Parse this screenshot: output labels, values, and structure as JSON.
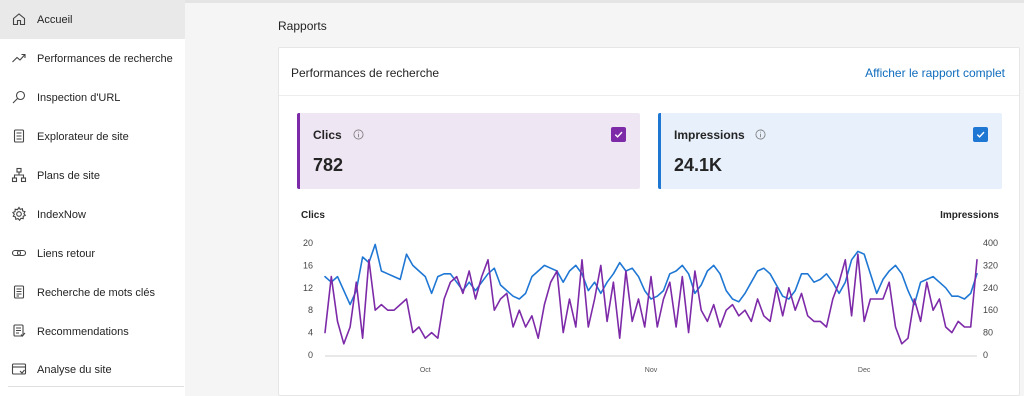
{
  "sidebar": {
    "items": [
      {
        "label": "Accueil",
        "icon": "home-icon",
        "active": true
      },
      {
        "label": "Performances de recherche",
        "icon": "trend-up-icon"
      },
      {
        "label": "Inspection d'URL",
        "icon": "search-icon"
      },
      {
        "label": "Explorateur de site",
        "icon": "document-icon"
      },
      {
        "label": "Plans de site",
        "icon": "sitemap-icon"
      },
      {
        "label": "IndexNow",
        "icon": "gear-icon"
      },
      {
        "label": "Liens retour",
        "icon": "link-icon"
      },
      {
        "label": "Recherche de mots clés",
        "icon": "document-list-icon"
      },
      {
        "label": "Recommendations",
        "icon": "recommendation-icon"
      },
      {
        "label": "Analyse du site",
        "icon": "window-icon"
      }
    ]
  },
  "main": {
    "section_title": "Rapports",
    "card": {
      "title": "Performances de recherche",
      "link_label": "Afficher le rapport complet",
      "metrics": {
        "clics": {
          "label": "Clics",
          "value": "782",
          "checked": true,
          "color": "#7d2aa8"
        },
        "impressions": {
          "label": "Impressions",
          "value": "24.1K",
          "checked": true,
          "color": "#1f77d4"
        }
      }
    }
  },
  "chart_data": {
    "type": "line",
    "left_axis_label": "Clics",
    "right_axis_label": "Impressions",
    "y_left_ticks": [
      "20",
      "16",
      "12",
      "8",
      "4",
      "0"
    ],
    "y_right_ticks": [
      "400",
      "320",
      "240",
      "160",
      "80",
      "0"
    ],
    "ylim_left": [
      0,
      20
    ],
    "ylim_right": [
      0,
      400
    ],
    "x_tick_labels": [
      "Oct",
      "Nov",
      "Dec"
    ],
    "x_tick_index": [
      16,
      52,
      86
    ],
    "grid": false,
    "series": [
      {
        "name": "Clics",
        "axis": "left",
        "color": "#7d2aa8",
        "values": [
          4,
          14,
          6,
          2,
          5,
          13,
          3,
          17,
          8,
          9,
          8,
          8,
          9,
          10,
          4,
          5,
          3,
          4,
          3,
          10,
          13,
          14,
          11,
          15,
          10,
          14,
          17,
          8,
          10,
          11,
          5,
          8,
          5,
          7,
          3,
          9,
          13,
          15,
          4,
          10,
          5,
          17,
          5,
          10,
          16,
          6,
          13,
          3,
          15,
          6,
          10,
          5,
          14,
          5,
          10,
          13,
          5,
          14,
          4,
          15,
          8,
          6,
          9,
          5,
          8,
          9,
          7,
          8,
          6,
          10,
          7,
          6,
          12,
          7,
          12,
          8,
          11,
          7,
          6,
          6,
          5,
          10,
          13,
          17,
          7,
          18,
          6,
          10,
          10,
          10,
          13,
          5,
          2,
          3,
          10,
          6,
          13,
          8,
          10,
          5,
          4,
          6,
          5,
          5,
          17
        ]
      },
      {
        "name": "Impressions",
        "axis": "right",
        "color": "#1f77d4",
        "values": [
          280,
          260,
          280,
          230,
          180,
          230,
          350,
          330,
          395,
          300,
          290,
          280,
          270,
          360,
          320,
          300,
          280,
          220,
          280,
          290,
          290,
          260,
          230,
          260,
          230,
          260,
          290,
          310,
          250,
          230,
          210,
          200,
          220,
          280,
          300,
          320,
          310,
          300,
          260,
          300,
          320,
          290,
          230,
          260,
          220,
          260,
          290,
          330,
          300,
          310,
          280,
          230,
          200,
          210,
          230,
          290,
          300,
          320,
          290,
          220,
          250,
          300,
          320,
          290,
          230,
          200,
          190,
          220,
          260,
          300,
          310,
          290,
          250,
          210,
          200,
          230,
          290,
          290,
          260,
          270,
          290,
          260,
          220,
          260,
          340,
          370,
          360,
          290,
          220,
          270,
          300,
          320,
          290,
          230,
          180,
          260,
          270,
          280,
          260,
          240,
          210,
          210,
          200,
          220,
          290
        ]
      }
    ]
  }
}
